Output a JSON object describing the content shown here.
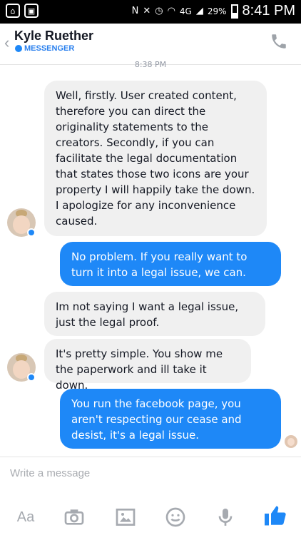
{
  "status_bar": {
    "time": "8:41 PM",
    "battery": "29%",
    "network": "4G",
    "left_icons": [
      "chat-icon",
      "image-icon"
    ]
  },
  "header": {
    "back": "‹",
    "contact_name": "Kyle Ruether",
    "platform": "MESSENGER"
  },
  "conversation": {
    "timestamp": "8:38 PM",
    "messages": [
      {
        "from": "them",
        "text": "Well, firstly. User created content, therefore you can direct the originality statements to the creators. Secondly, if you can facilitate the legal documentation that states those two icons are your property I will happily take the down. I apologize for any inconvenience caused."
      },
      {
        "from": "me",
        "text": "No problem.  If you really want to turn it into a legal issue, we can."
      },
      {
        "from": "them",
        "text": "Im not saying I want a legal issue, just the legal proof."
      },
      {
        "from": "them",
        "text": "It's pretty simple. You show me the paperwork and ill take it down."
      },
      {
        "from": "me",
        "text": "You run the facebook page, you aren't respecting our cease and desist, it's a legal issue."
      }
    ]
  },
  "composer": {
    "placeholder": "Write a message",
    "toolbar": {
      "text_label": "Aa",
      "icons": [
        "camera-icon",
        "gallery-icon",
        "emoji-icon",
        "microphone-icon",
        "like-icon"
      ]
    }
  },
  "colors": {
    "accent": "#1e88f7",
    "incoming_bubble": "#f0f0f0"
  }
}
